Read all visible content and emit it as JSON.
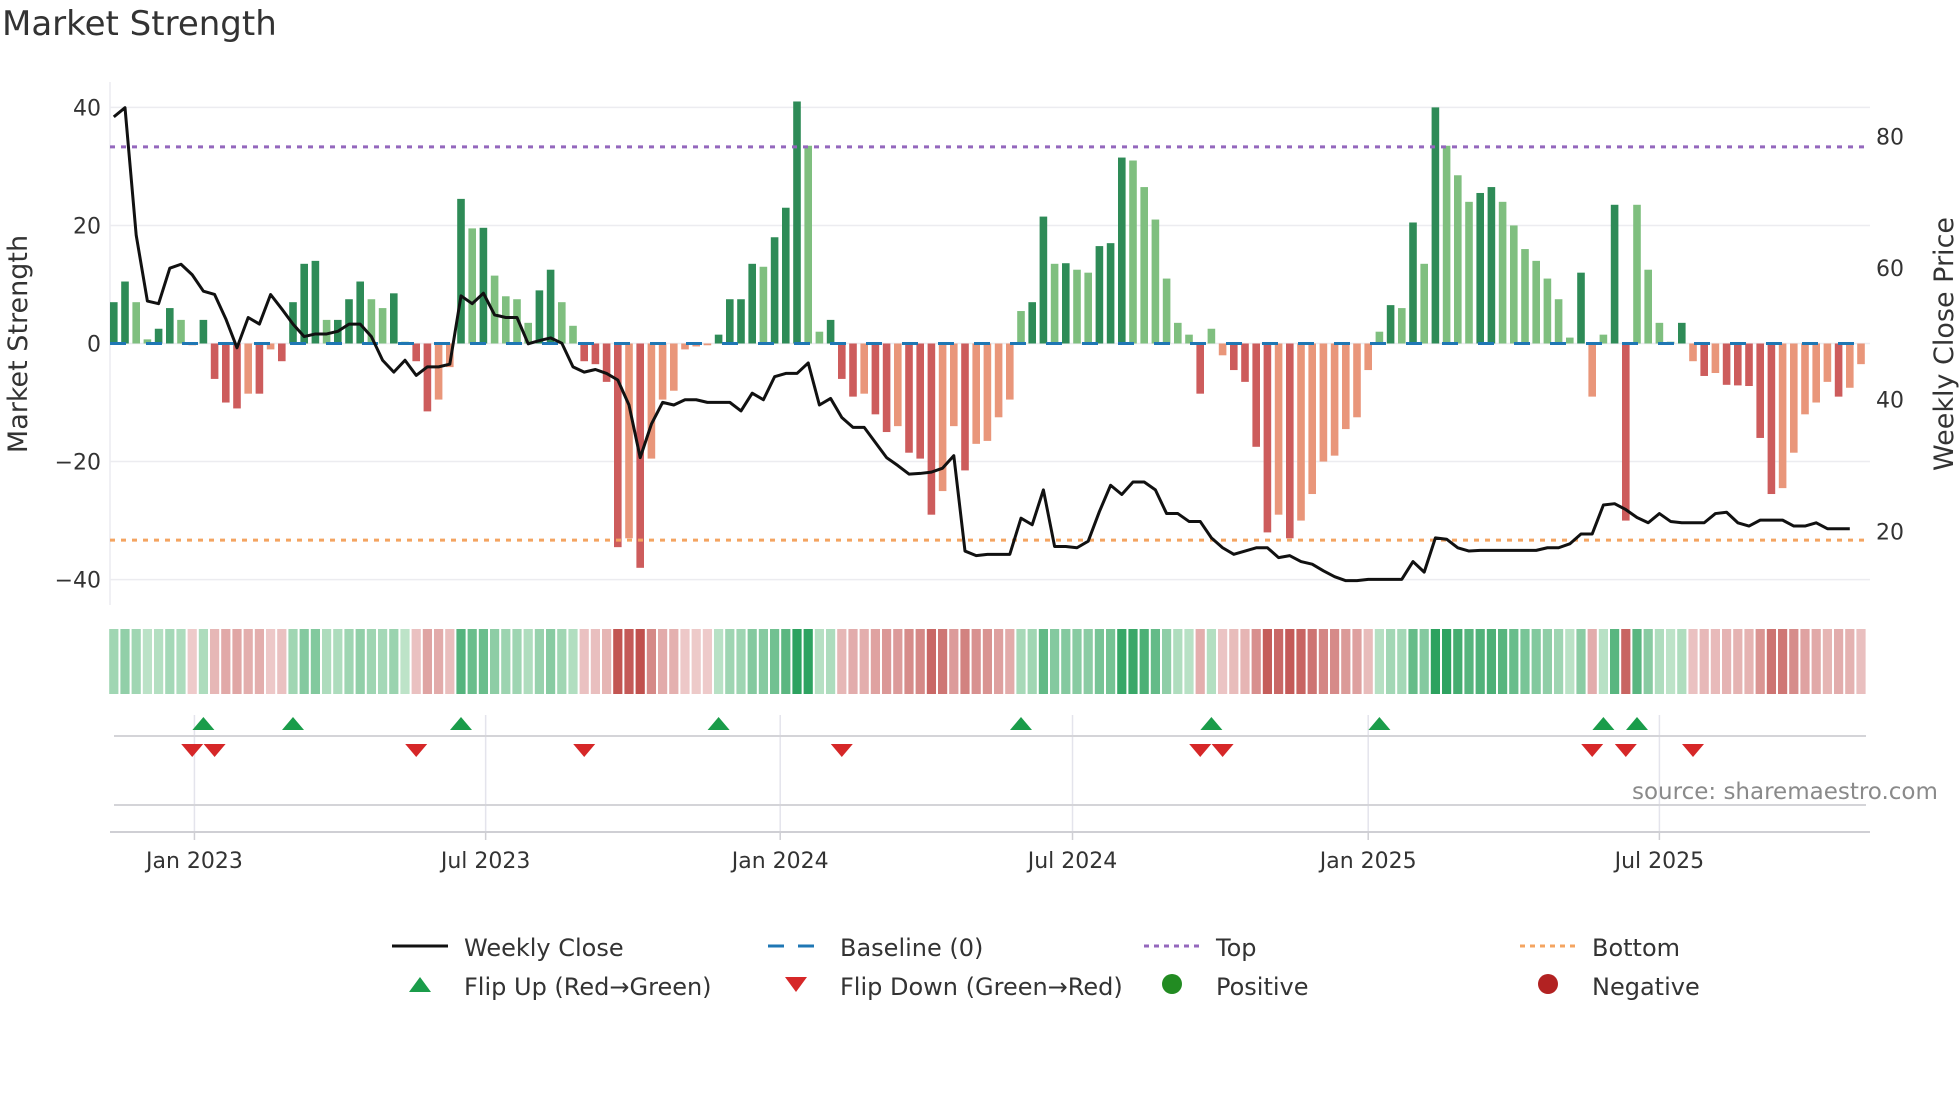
{
  "title": "Market Strength",
  "source": "source: sharemaestro.com",
  "chart_data": {
    "type": "bar",
    "title": "Market Strength",
    "ylabel": "Market Strength",
    "y2label": "Weekly Close Price",
    "ylim": [
      -44.3,
      44.3
    ],
    "y2lim": [
      8.8,
      88.3
    ],
    "yticks": [
      40,
      20,
      0,
      -20,
      -40
    ],
    "ytick_labels": [
      "40",
      "20",
      "0",
      "−20",
      "−40"
    ],
    "y2ticks": [
      80,
      60,
      40,
      20
    ],
    "y2tick_labels": [
      "80",
      "60",
      "40",
      "20"
    ],
    "top_threshold": 33.3,
    "bottom_threshold": -33.3,
    "x_unit": "week index",
    "xticks": [
      7.2,
      33.2,
      59.5,
      85.6,
      112,
      138
    ],
    "xtick_labels": [
      "Jan 2023",
      "Jul 2023",
      "Jan 2024",
      "Jul 2024",
      "Jan 2025",
      "Jul 2025"
    ],
    "strength": [
      7,
      10.5,
      7,
      0.7,
      2.5,
      6,
      4,
      -0.3,
      4,
      -6,
      -10,
      -11,
      -8.5,
      -8.5,
      -1,
      -3,
      7,
      13.5,
      14,
      4,
      4,
      7.5,
      10.5,
      7.5,
      6,
      8.5,
      0.3,
      -3,
      -11.5,
      -9.5,
      -4,
      24.5,
      19.5,
      19.6,
      11.5,
      8,
      7.5,
      3.5,
      9,
      12.5,
      7,
      3,
      -3,
      -3.5,
      -6.5,
      -34.5,
      -33,
      -38,
      -19.5,
      -9.5,
      -8,
      -1,
      -0.5,
      -0.3,
      1.5,
      7.5,
      7.5,
      13.5,
      13,
      18,
      23,
      41,
      33.5,
      2,
      4,
      -6,
      -9,
      -8.5,
      -12,
      -15,
      -14,
      -18.5,
      -19.5,
      -29,
      -25,
      -14,
      -21.5,
      -17,
      -16.5,
      -12.5,
      -9.5,
      5.5,
      7,
      21.5,
      13.5,
      13.6,
      12.5,
      12,
      16.5,
      17,
      31.5,
      31,
      26.5,
      21,
      11,
      3.5,
      1.5,
      -8.5,
      2.5,
      -2,
      -4.5,
      -6.5,
      -17.5,
      -32,
      -29,
      -33,
      -30,
      -25.5,
      -20,
      -19,
      -14.5,
      -12.5,
      -4.5,
      2,
      6.5,
      6,
      20.5,
      13.5,
      40,
      33.5,
      28.5,
      24,
      25.5,
      26.5,
      24,
      20,
      16,
      14,
      11,
      7.5,
      1,
      12,
      -9,
      1.5,
      23.5,
      -30,
      23.5,
      12.5,
      3.5,
      0.3,
      3.5,
      -3,
      -5.5,
      -5,
      -7,
      -7.1,
      -7.2,
      -16,
      -25.5,
      -24.5,
      -18.5,
      -12,
      -10,
      -6.5,
      -9,
      -7.5,
      -3.5
    ],
    "weekly_close": [
      83,
      84.4,
      65,
      55,
      54.6,
      60,
      60.6,
      59,
      56.5,
      56,
      52.3,
      47.9,
      52.5,
      51.5,
      56,
      53.8,
      51.5,
      49.6,
      50,
      50,
      50.4,
      51.5,
      51.5,
      49.6,
      46,
      44.2,
      46,
      43.7,
      45,
      45,
      45.4,
      55.8,
      54.6,
      56.2,
      52.9,
      52.5,
      52.5,
      48.5,
      49,
      49.4,
      48.6,
      45,
      44.2,
      44.6,
      44,
      43,
      39.2,
      31.2,
      36.3,
      39.6,
      39.2,
      40,
      40,
      39.6,
      39.6,
      39.6,
      38.3,
      41,
      40,
      43.5,
      44,
      44,
      45.6,
      39.2,
      40.2,
      37.3,
      35.8,
      35.8,
      33.5,
      31.2,
      30,
      28.7,
      28.8,
      29,
      29.6,
      31.5,
      17,
      16.3,
      16.5,
      16.5,
      16.5,
      22,
      21,
      26.3,
      17.7,
      17.7,
      17.5,
      18.5,
      23,
      27,
      25.6,
      27.5,
      27.5,
      26.3,
      22.7,
      22.7,
      21.5,
      21.5,
      19,
      17.5,
      16.5,
      17,
      17.5,
      17.5,
      16,
      16.3,
      15.4,
      15,
      14,
      13.1,
      12.5,
      12.5,
      12.7,
      12.7,
      12.7,
      12.7,
      15.4,
      13.8,
      19,
      18.8,
      17.5,
      17,
      17.1,
      17.1,
      17.1,
      17.1,
      17.1,
      17.1,
      17.5,
      17.5,
      18.1,
      19.6,
      19.6,
      24,
      24.2,
      23.3,
      22.1,
      21.3,
      22.7,
      21.5,
      21.3,
      21.3,
      21.3,
      22.7,
      22.9,
      21.3,
      20.8,
      21.7,
      21.7,
      21.7,
      20.8,
      20.8,
      21.3,
      20.4,
      20.4,
      20.4
    ],
    "flip_up": [
      8,
      16,
      31,
      54,
      81,
      98,
      113,
      133,
      136
    ],
    "flip_down": [
      7,
      9,
      27,
      42,
      65,
      97,
      99,
      132,
      135,
      141
    ],
    "legend_position": "bottom",
    "legend": [
      {
        "label": "Weekly Close",
        "kind": "line"
      },
      {
        "label": "Baseline (0)",
        "kind": "dash"
      },
      {
        "label": "Top",
        "kind": "dot-purple"
      },
      {
        "label": "Bottom",
        "kind": "dot-orange"
      },
      {
        "label": "Flip Up (Red→Green)",
        "kind": "tri-up"
      },
      {
        "label": "Flip Down (Green→Red)",
        "kind": "tri-down"
      },
      {
        "label": "Positive",
        "kind": "dot-green"
      },
      {
        "label": "Negative",
        "kind": "dot-red"
      }
    ]
  },
  "colors": {
    "pos_strong": "#2e8b57",
    "pos_weak": "#7fbf7f",
    "neg_strong": "#cd5c5c",
    "neg_weak": "#e9967a",
    "baseline": "#1f77b4",
    "top": "#9467bd",
    "bottom": "#f4a460",
    "flip_up": "#1a9c4a",
    "flip_down": "#d62728",
    "positive": "#228b22",
    "negative": "#b22222"
  }
}
